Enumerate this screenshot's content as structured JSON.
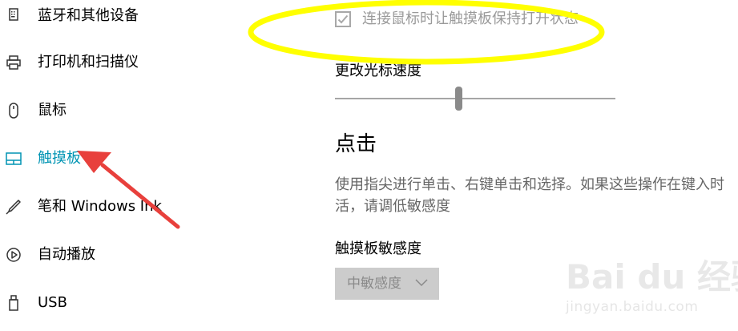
{
  "sidebar": {
    "items": [
      {
        "label": "蓝牙和其他设备",
        "icon": "keyboard-icon"
      },
      {
        "label": "打印机和扫描仪",
        "icon": "printer-icon"
      },
      {
        "label": "鼠标",
        "icon": "mouse-icon"
      },
      {
        "label": "触摸板",
        "icon": "touchpad-icon",
        "selected": true
      },
      {
        "label": "笔和 Windows Ink",
        "icon": "pen-icon"
      },
      {
        "label": "自动播放",
        "icon": "autoplay-icon"
      },
      {
        "label": "USB",
        "icon": "usb-icon"
      }
    ]
  },
  "main": {
    "mouse_checkbox": {
      "label": "连接鼠标时让触摸板保持打开状态",
      "checked": true
    },
    "cursor_speed": {
      "label": "更改光标速度",
      "value_fraction": 0.44
    },
    "tap_section": {
      "title": "点击",
      "description_lines": [
        "使用指尖进行单击、右键单击和选择。如果这些操作在键入时",
        "活，请调低敏感度"
      ]
    },
    "sensitivity": {
      "label": "触摸板敏感度",
      "selected": "中敏感度"
    }
  },
  "watermark": {
    "logo": "Bai du 经验",
    "url": "jingyan.baidu.com"
  },
  "colors": {
    "accent": "#0094b3",
    "highlight_ellipse": "#ffff00",
    "arrow": "#e8403c",
    "checkbox_disabled": "#a8a8a8",
    "dropdown_bg": "#cccccc"
  }
}
